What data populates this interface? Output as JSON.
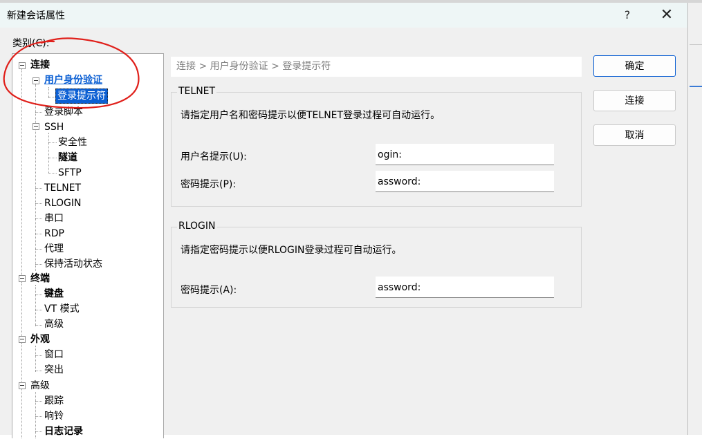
{
  "dialog": {
    "title": "新建会话属性",
    "help_glyph": "?",
    "close_glyph": "✕"
  },
  "category_label": "类别(C):",
  "tree": {
    "items": [
      {
        "label": "连接",
        "bold": true
      },
      {
        "label": "用户身份验证",
        "bold": true
      },
      {
        "label": "登录提示符",
        "selected": true
      },
      {
        "label": "登录脚本"
      },
      {
        "label": "SSH"
      },
      {
        "label": "安全性"
      },
      {
        "label": "隧道",
        "bold": true
      },
      {
        "label": "SFTP"
      },
      {
        "label": "TELNET"
      },
      {
        "label": "RLOGIN"
      },
      {
        "label": "串口"
      },
      {
        "label": "RDP"
      },
      {
        "label": "代理"
      },
      {
        "label": "保持活动状态"
      },
      {
        "label": "终端",
        "bold": true
      },
      {
        "label": "键盘",
        "bold": true
      },
      {
        "label": "VT 模式"
      },
      {
        "label": "高级"
      },
      {
        "label": "外观",
        "bold": true
      },
      {
        "label": "窗口"
      },
      {
        "label": "突出"
      },
      {
        "label": "高级"
      },
      {
        "label": "跟踪"
      },
      {
        "label": "响铃"
      },
      {
        "label": "日志记录",
        "bold": true
      }
    ]
  },
  "breadcrumb": "连接 > 用户身份验证 > 登录提示符",
  "telnet": {
    "title": "TELNET",
    "description": "请指定用户名和密码提示以便TELNET登录过程可自动运行。",
    "username_label": "用户名提示(U):",
    "username_value": "ogin:",
    "password_label": "密码提示(P):",
    "password_value": "assword:"
  },
  "rlogin": {
    "title": "RLOGIN",
    "description": "请指定密码提示以便RLOGIN登录过程可自动运行。",
    "password_label": "密码提示(A):",
    "password_value": "assword:"
  },
  "buttons": {
    "ok": "确定",
    "connect": "连接",
    "cancel": "取消"
  },
  "colors": {
    "selection": "#0b5fd3",
    "annotation": "#e0201b"
  }
}
